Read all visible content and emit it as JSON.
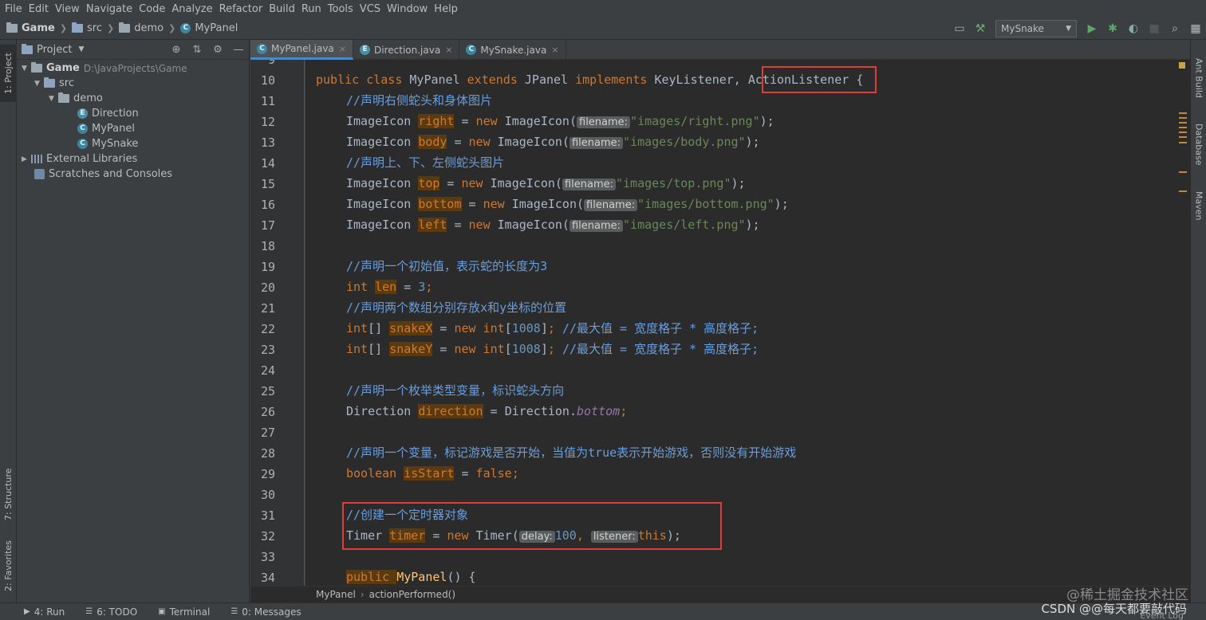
{
  "menu": [
    "File",
    "Edit",
    "View",
    "Navigate",
    "Code",
    "Analyze",
    "Refactor",
    "Build",
    "Run",
    "Tools",
    "VCS",
    "Window",
    "Help"
  ],
  "breadcrumb": {
    "project": "Game",
    "src": "src",
    "pkg": "demo",
    "file": "MyPanel"
  },
  "run_config": "MySnake",
  "left_tabs": {
    "project": "1: Project",
    "structure": "7: Structure",
    "favorites": "2: Favorites"
  },
  "project_panel": {
    "title": "Project",
    "tree": [
      {
        "label": "Game",
        "path": "D:\\JavaProjects\\Game"
      },
      {
        "label": "src"
      },
      {
        "label": "demo"
      },
      {
        "label": "Direction"
      },
      {
        "label": "MyPanel"
      },
      {
        "label": "MySnake"
      },
      {
        "label": "External Libraries"
      },
      {
        "label": "Scratches and Consoles"
      }
    ]
  },
  "tabs": [
    "MyPanel.java",
    "Direction.java",
    "MySnake.java"
  ],
  "line_numbers": [
    "9",
    "10",
    "11",
    "12",
    "13",
    "14",
    "15",
    "16",
    "17",
    "18",
    "19",
    "20",
    "21",
    "22",
    "23",
    "24",
    "25",
    "26",
    "27",
    "28",
    "29",
    "30",
    "31",
    "32",
    "33",
    "34"
  ],
  "code": {
    "l10_a": "public class ",
    "l10_b": "MyPanel ",
    "l10_c": "extends ",
    "l10_d": "JPanel ",
    "l10_e": "implements ",
    "l10_f": "KeyListener, ",
    "l10_g": "ActionListener",
    "l10_h": " {",
    "l11": "//声明右侧蛇头和身体图片",
    "l12_type": "ImageIcon ",
    "l12_var": "right",
    "l12_eq": " = ",
    "l12_new": "new ",
    "l12_cls": "ImageIcon(",
    "l12_hint": "filename:",
    "l12_str": "\"images/right.png\"",
    "l12_end": ");",
    "l13_var": "body",
    "l13_str": "\"images/body.png\"",
    "l14": "//声明上、下、左侧蛇头图片",
    "l15_var": "top",
    "l15_str": "\"images/top.png\"",
    "l16_var": "bottom",
    "l16_str": "\"images/bottom.png\"",
    "l17_var": "left",
    "l17_str": "\"images/left.png\"",
    "l19": "//声明一个初始值，表示蛇的长度为3",
    "l20_type": "int ",
    "l20_var": "len",
    "l20_eq": " = ",
    "l20_num": "3",
    "l20_end": ";",
    "l21": "//声明两个数组分别存放x和y坐标的位置",
    "l22_type": "int",
    "l22_br": "[] ",
    "l22_var": "snakeX",
    "l22_new": "new ",
    "l22_int": "int",
    "l22_lb": "[",
    "l22_num": "1008",
    "l22_rb": "]",
    "l22_semi": "; ",
    "l22_cm": "//最大值 = 宽度格子 * 高度格子;",
    "l23_var": "snakeY",
    "l25": "//声明一个枚举类型变量，标识蛇头方向",
    "l26_type": "Direction ",
    "l26_var": "direction",
    "l26_cls": "Direction.",
    "l26_fld": "bottom",
    "l26_end": ";",
    "l28": "//声明一个变量，标记游戏是否开始，当值为true表示开始游戏，否则没有开始游戏",
    "l29_type": "boolean ",
    "l29_var": "isStart",
    "l29_val": "false",
    "l29_end": ";",
    "l31": "//创建一个定时器对象",
    "l32_type": "Timer ",
    "l32_var": "timer",
    "l32_cls": "Timer(",
    "l32_hint1": "delay:",
    "l32_num": "100",
    "l32_comma": ", ",
    "l32_hint2": "listener:",
    "l32_this": "this",
    "l32_end": ");",
    "l34_kw": "public ",
    "l34_fn": "MyPanel",
    "l34_end": "() {"
  },
  "right_tabs": {
    "ant": "Ant Build",
    "database": "Database",
    "maven": "Maven"
  },
  "editor_breadcrumb": {
    "cls": "MyPanel",
    "method": "actionPerformed()"
  },
  "bottom_tabs": [
    "4: Run",
    "6: TODO",
    "Terminal",
    "0: Messages"
  ],
  "watermark": {
    "line1": "@稀土掘金技术社区",
    "line2": "CSDN @@每天都要敲代码"
  },
  "event_log": "Event Log"
}
